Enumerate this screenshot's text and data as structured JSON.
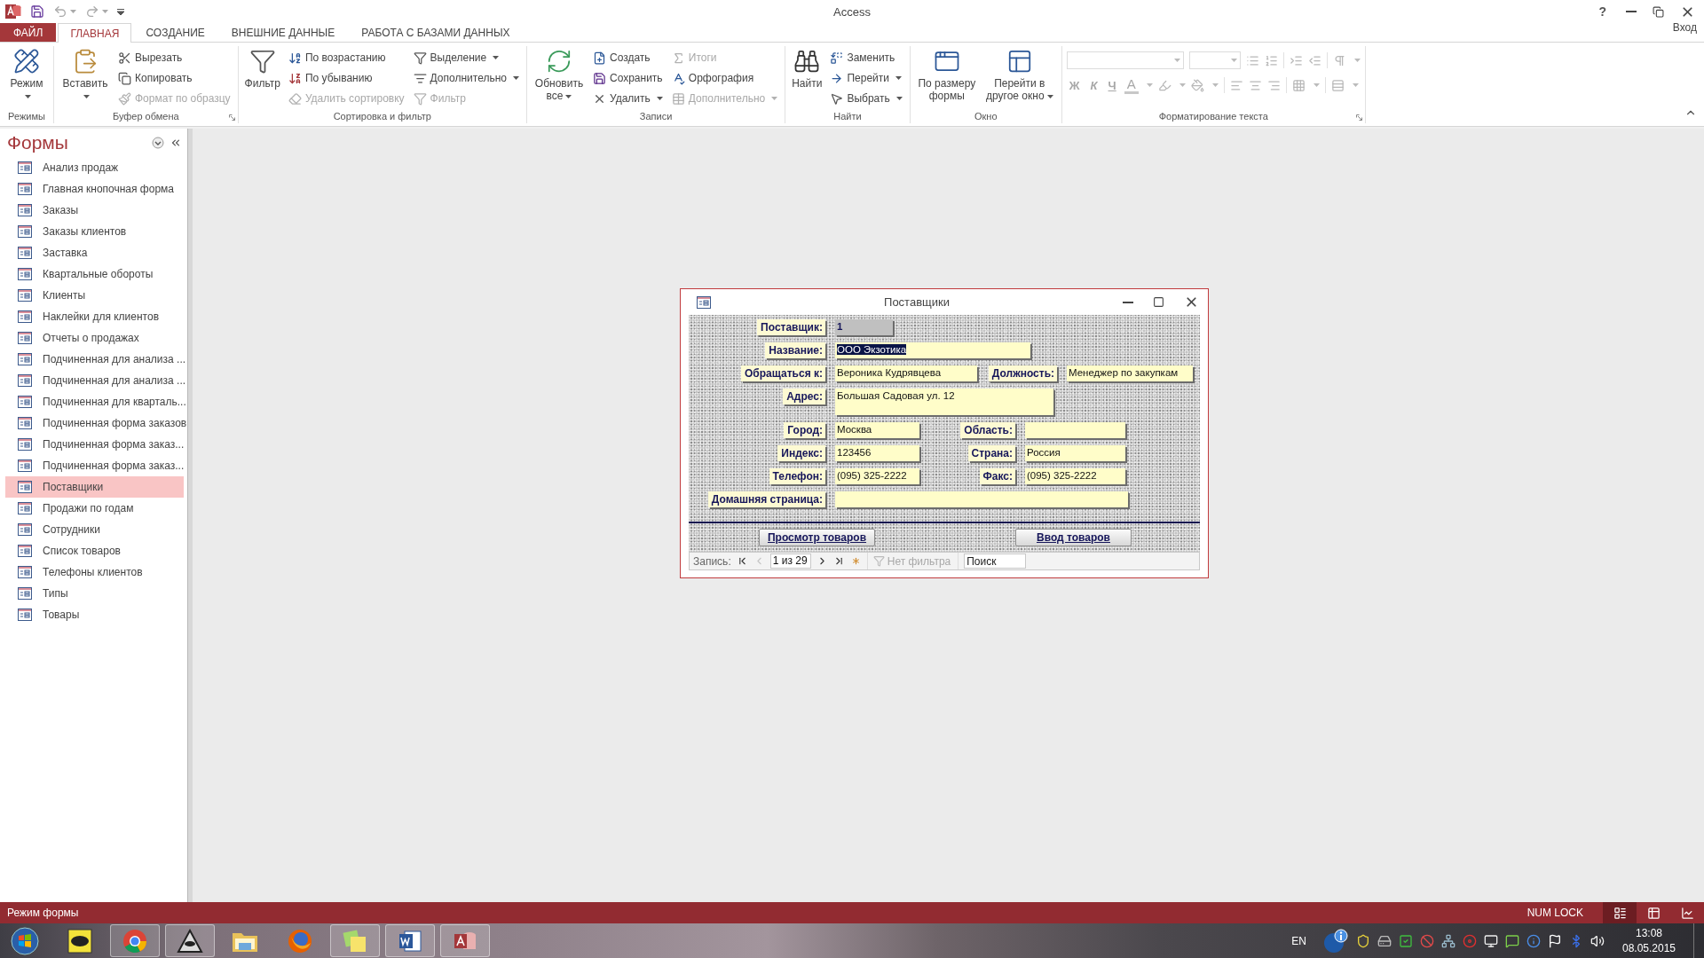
{
  "window": {
    "title": "Access",
    "help": "?",
    "sign_in": "Вход"
  },
  "tabs": [
    {
      "label": "ФАЙЛ",
      "kind": "file",
      "selected": false
    },
    {
      "label": "ГЛАВНАЯ",
      "kind": "tab",
      "selected": true
    },
    {
      "label": "СОЗДАНИЕ",
      "kind": "tab",
      "selected": false
    },
    {
      "label": "ВНЕШНИЕ ДАННЫЕ",
      "kind": "tab",
      "selected": false
    },
    {
      "label": "РАБОТА С БАЗАМИ ДАННЫХ",
      "kind": "tab",
      "selected": false
    }
  ],
  "ribbon": [
    {
      "title": "Режимы",
      "kind": "commands",
      "launcher": false,
      "large": [
        {
          "label": "Режим",
          "dropdown": true
        }
      ]
    },
    {
      "title": "Буфер обмена",
      "kind": "commands",
      "launcher": true,
      "large": [
        {
          "label": "Вставить",
          "dropdown": true
        }
      ],
      "columns": [
        [
          {
            "label": "Вырезать",
            "disabled": false,
            "dropdown": false
          },
          {
            "label": "Копировать",
            "disabled": false,
            "dropdown": false
          },
          {
            "label": "Формат по образцу",
            "disabled": true,
            "dropdown": false
          }
        ]
      ]
    },
    {
      "title": "Сортировка и фильтр",
      "kind": "commands",
      "launcher": false,
      "large": [
        {
          "label": "Фильтр",
          "dropdown": false
        }
      ],
      "columns": [
        [
          {
            "label": "По возрастанию",
            "disabled": false,
            "dropdown": false
          },
          {
            "label": "По убыванию",
            "disabled": false,
            "dropdown": false
          },
          {
            "label": "Удалить сортировку",
            "disabled": true,
            "dropdown": false
          }
        ],
        [
          {
            "label": "Выделение",
            "disabled": false,
            "dropdown": true
          },
          {
            "label": "Дополнительно",
            "disabled": false,
            "dropdown": true
          },
          {
            "label": "Фильтр",
            "disabled": true,
            "dropdown": false
          }
        ]
      ]
    },
    {
      "title": "Записи",
      "kind": "commands",
      "launcher": false,
      "large": [
        {
          "label": "Обновить все",
          "dropdown": true
        }
      ],
      "columns": [
        [
          {
            "label": "Создать",
            "disabled": false,
            "dropdown": false
          },
          {
            "label": "Сохранить",
            "disabled": false,
            "dropdown": false
          },
          {
            "label": "Удалить",
            "disabled": false,
            "dropdown": true
          }
        ],
        [
          {
            "label": "Итоги",
            "disabled": true,
            "dropdown": false
          },
          {
            "label": "Орфография",
            "disabled": false,
            "dropdown": false
          },
          {
            "label": "Дополнительно",
            "disabled": true,
            "dropdown": true
          }
        ]
      ]
    },
    {
      "title": "Найти",
      "kind": "commands",
      "launcher": false,
      "large": [
        {
          "label": "Найти",
          "dropdown": false
        }
      ],
      "columns": [
        [
          {
            "label": "Заменить",
            "disabled": false,
            "dropdown": false
          },
          {
            "label": "Перейти",
            "disabled": false,
            "dropdown": true
          },
          {
            "label": "Выбрать",
            "disabled": false,
            "dropdown": true
          }
        ]
      ]
    },
    {
      "title": "Окно",
      "kind": "commands",
      "launcher": false,
      "large": [
        {
          "label": "По размеру формы",
          "dropdown": false
        },
        {
          "label": "Перейти в другое окно",
          "dropdown": true
        }
      ]
    },
    {
      "title": "Форматирование текста",
      "kind": "formatting",
      "launcher": true,
      "letters": [
        {
          "label": "Ж"
        },
        {
          "label": "К"
        },
        {
          "label": "Ч"
        },
        {
          "label": "A"
        }
      ]
    }
  ],
  "navigation": {
    "title": "Формы",
    "items": [
      {
        "label": "Анализ продаж",
        "selected": false
      },
      {
        "label": "Главная кнопочная форма",
        "selected": false
      },
      {
        "label": "Заказы",
        "selected": false
      },
      {
        "label": "Заказы клиентов",
        "selected": false
      },
      {
        "label": "Заставка",
        "selected": false
      },
      {
        "label": "Квартальные обороты",
        "selected": false
      },
      {
        "label": "Клиенты",
        "selected": false
      },
      {
        "label": "Наклейки для клиентов",
        "selected": false
      },
      {
        "label": "Отчеты о продажах",
        "selected": false
      },
      {
        "label": "Подчиненная для анализа ...",
        "selected": false
      },
      {
        "label": "Подчиненная для анализа ...",
        "selected": false
      },
      {
        "label": "Подчиненная для кварталь...",
        "selected": false
      },
      {
        "label": "Подчиненная форма заказов",
        "selected": false
      },
      {
        "label": "Подчиненная форма заказ...",
        "selected": false
      },
      {
        "label": "Подчиненная форма заказ...",
        "selected": false
      },
      {
        "label": "Поставщики",
        "selected": true
      },
      {
        "label": "Продажи по годам",
        "selected": false
      },
      {
        "label": "Сотрудники",
        "selected": false
      },
      {
        "label": "Список товаров",
        "selected": false
      },
      {
        "label": "Телефоны клиентов",
        "selected": false
      },
      {
        "label": "Типы",
        "selected": false
      },
      {
        "label": "Товары",
        "selected": false
      }
    ]
  },
  "form_window": {
    "title": "Поставщики",
    "rows": [
      {
        "fields": [
          {
            "label": "Поставщик:",
            "value": "1",
            "kind": "locked",
            "selected": false
          }
        ]
      },
      {
        "fields": [
          {
            "label": "Название:",
            "value": "ООО Экзотика",
            "kind": "text",
            "selected": true
          }
        ]
      },
      {
        "fields": [
          {
            "label": "Обращаться к:",
            "value": "Вероника Кудрявцева",
            "kind": "text",
            "selected": false
          },
          {
            "label": "Должность:",
            "value": "Менеджер по закупкам",
            "kind": "text",
            "selected": false
          }
        ]
      },
      {
        "fields": [
          {
            "label": "Адрес:",
            "value": "Большая Садовая ул. 12",
            "kind": "text",
            "selected": false
          }
        ]
      },
      {
        "fields": [
          {
            "label": "Город:",
            "value": "Москва",
            "kind": "text",
            "selected": false
          },
          {
            "label": "Область:",
            "kind": "text"
          }
        ]
      },
      {
        "fields": [
          {
            "label": "Индекс:",
            "value": "123456",
            "kind": "text",
            "selected": false
          },
          {
            "label": "Страна:",
            "value": "Россия",
            "kind": "text",
            "selected": false
          }
        ]
      },
      {
        "fields": [
          {
            "label": "Телефон:",
            "value": "(095) 325-2222",
            "kind": "text",
            "selected": false
          },
          {
            "label": "Факс:",
            "value": "(095) 325-2222",
            "kind": "text",
            "selected": false
          }
        ]
      },
      {
        "fields": [
          {
            "label": "Домашняя страница:",
            "kind": "text"
          }
        ]
      }
    ],
    "buttons": [
      {
        "label": "Просмотр товаров"
      },
      {
        "label": "Ввод товаров"
      }
    ],
    "record_nav": {
      "label": "Запись:",
      "position": "1 из 29",
      "buttons": [
        {
          "disabled": false
        },
        {
          "disabled": true
        },
        {
          "disabled": false
        },
        {
          "disabled": false
        },
        {
          "disabled": false
        }
      ],
      "filter": "Нет фильтра",
      "search": {
        "placeholder": "Поиск"
      }
    }
  },
  "status_bar": {
    "mode": "Режим формы",
    "indicator": "NUM LOCK",
    "views": [
      {
        "selected": true
      },
      {
        "selected": false
      },
      {
        "selected": false
      }
    ]
  },
  "taskbar": {
    "apps": [
      {
        "running": false
      },
      {
        "running": true
      },
      {
        "running": true
      },
      {
        "running": false
      },
      {
        "running": false
      },
      {
        "running": true
      },
      {
        "running": true
      },
      {
        "running": true
      }
    ],
    "language": "EN",
    "time": "13:08",
    "date": "08.05.2015"
  }
}
